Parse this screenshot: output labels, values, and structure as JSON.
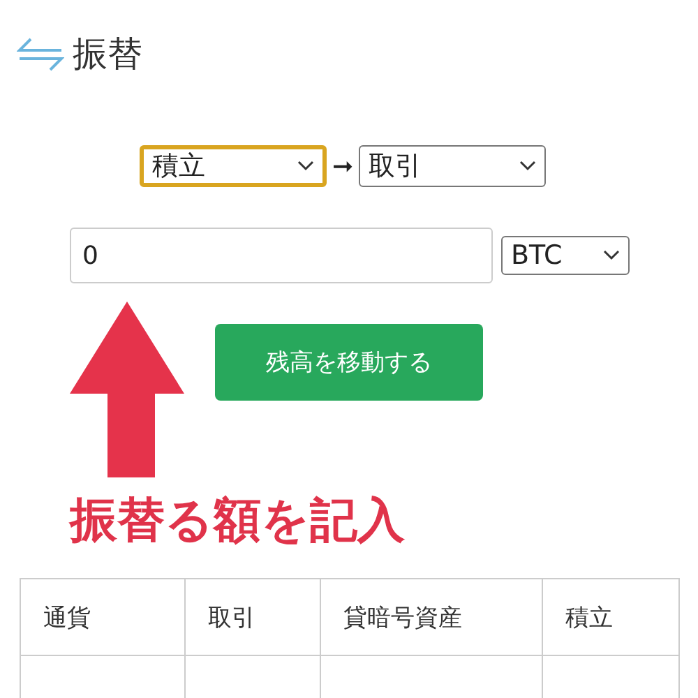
{
  "header": {
    "title": "振替"
  },
  "transfer": {
    "from": {
      "value": "積立",
      "focused": true
    },
    "arrow": "➞",
    "to": {
      "value": "取引",
      "focused": false
    }
  },
  "amount": {
    "value": "0",
    "currency": "BTC"
  },
  "move_button": "残高を移動する",
  "annotation": {
    "text": "振替る額を記入"
  },
  "table": {
    "columns": [
      "通貨",
      "取引",
      "貸暗号資産",
      "積立"
    ]
  }
}
